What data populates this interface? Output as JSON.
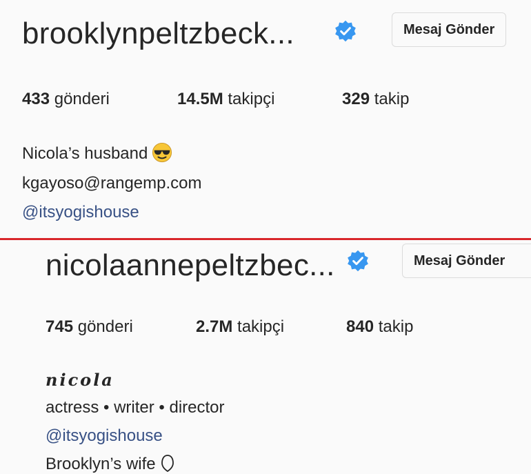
{
  "profiles": [
    {
      "username": "brooklynpeltzbeck...",
      "message_button": "Mesaj Gönder",
      "stats": {
        "posts_count": "433",
        "posts_label": "gönderi",
        "followers_count": "14.5M",
        "followers_label": "takipçi",
        "following_count": "329",
        "following_label": "takip"
      },
      "bio": {
        "line1": "Nicola’s husband",
        "line2": "kgayoso@rangemp.com",
        "link": "@itsyogishouse"
      }
    },
    {
      "username": "nicolaannepeltzbec...",
      "message_button": "Mesaj Gönder",
      "stats": {
        "posts_count": "745",
        "posts_label": "gönderi",
        "followers_count": "2.7M",
        "followers_label": "takipçi",
        "following_count": "840",
        "following_label": "takip"
      },
      "bio": {
        "name": "nicola",
        "line1": "actress • writer • director",
        "link": "@itsyogishouse",
        "line3": "Brooklyn’s wife"
      }
    }
  ],
  "colors": {
    "verified": "#3897f0",
    "link": "#385185",
    "divider": "#d9262b"
  },
  "icons": {
    "verified": "verified-badge-icon",
    "emoji": "sunglasses-emoji-icon",
    "heart": "heart-icon"
  }
}
